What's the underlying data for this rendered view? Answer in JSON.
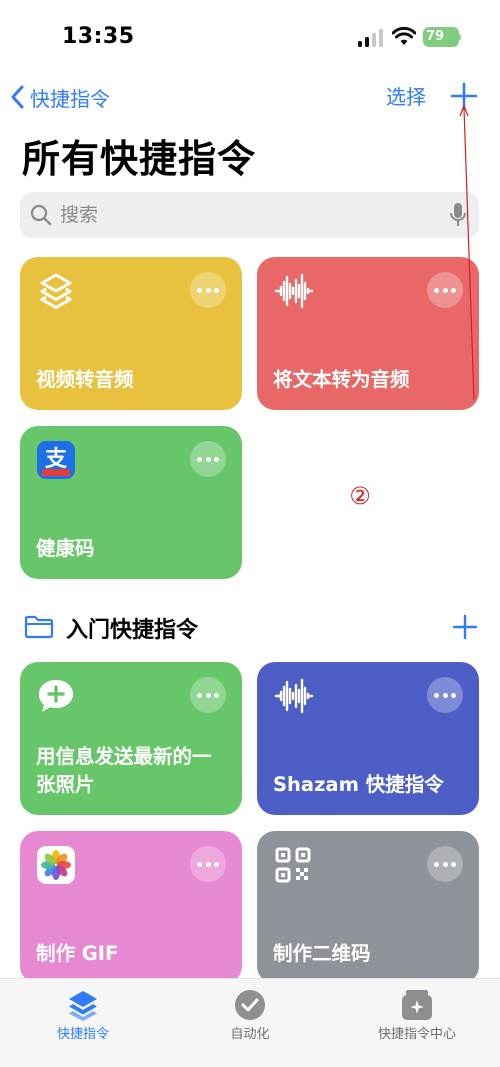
{
  "status_bar": {
    "time": "13:35",
    "battery": "79"
  },
  "nav": {
    "back_label": "快捷指令",
    "select_label": "选择"
  },
  "page_title": "所有快捷指令",
  "search": {
    "placeholder": "搜索"
  },
  "shortcuts": [
    {
      "label": "视频转音频",
      "color": "#e8c23e",
      "icon": "layers-icon"
    },
    {
      "label": "将文本转为音频",
      "color": "#e86868",
      "icon": "waveform-icon"
    },
    {
      "label": "健康码",
      "color": "#68c66a",
      "icon": "alipay-icon"
    }
  ],
  "annotation": {
    "number": "②",
    "color": "#d42020"
  },
  "section": {
    "title": "入门快捷指令"
  },
  "starter_shortcuts": [
    {
      "label": "用信息发送最新的一张照片",
      "color": "#68c66a",
      "icon": "message-plus-icon"
    },
    {
      "label": "Shazam 快捷指令",
      "color": "#4d5fc7",
      "icon": "waveform-icon"
    },
    {
      "label": "制作 GIF",
      "color": "#e688d2",
      "icon": "photos-icon"
    },
    {
      "label": "制作二维码",
      "color": "#8e9399",
      "icon": "qr-code-icon"
    }
  ],
  "tabs": [
    {
      "label": "快捷指令",
      "active": true
    },
    {
      "label": "自动化",
      "active": false
    },
    {
      "label": "快捷指令中心",
      "active": false
    }
  ],
  "colors": {
    "accent": "#2f7cf6",
    "tab_inactive": "#8e8e93"
  }
}
